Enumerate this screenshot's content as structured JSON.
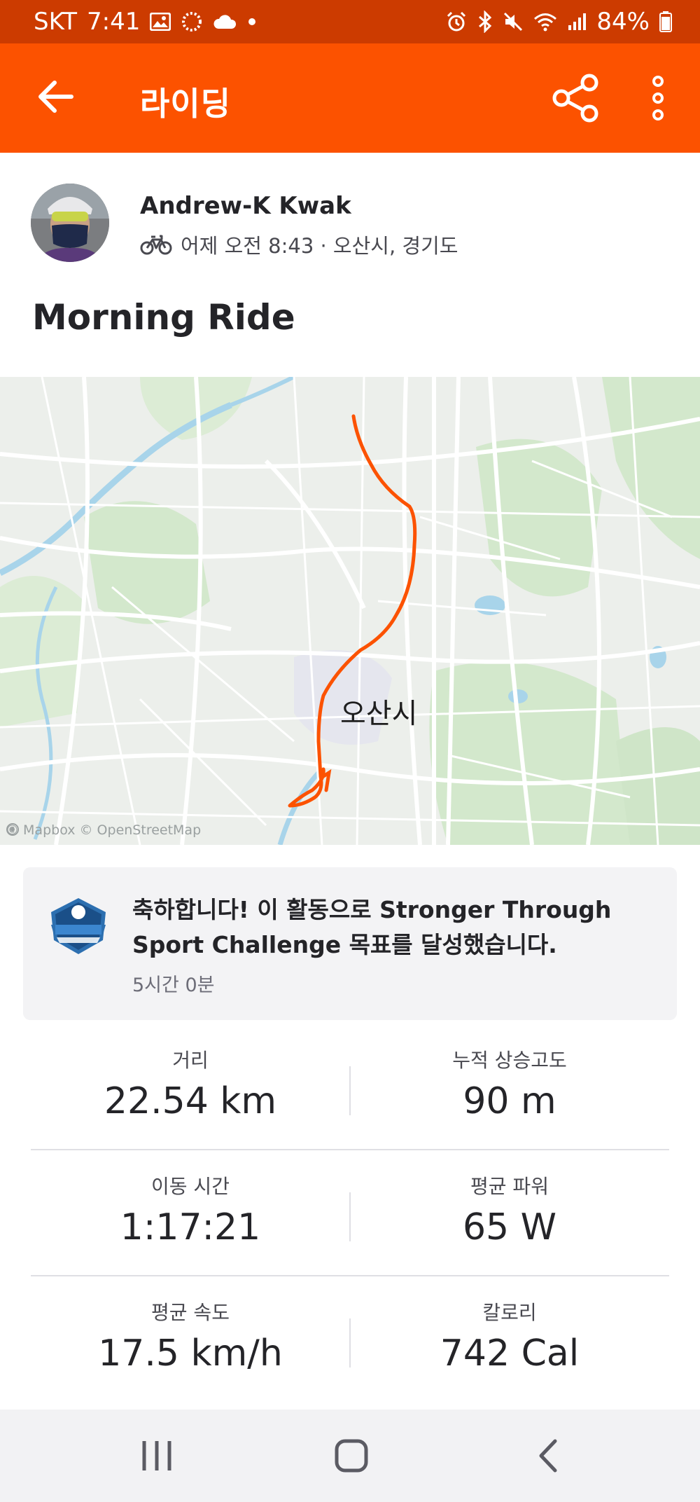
{
  "status_bar": {
    "carrier": "SKT",
    "time": "7:41",
    "battery": "84%",
    "left_icons": [
      "gallery-icon",
      "loading-icon",
      "cloud-icon",
      "dot-icon"
    ],
    "right_icons": [
      "alarm-icon",
      "bluetooth-icon",
      "mute-icon",
      "wifi-icon",
      "signal-icon",
      "battery-icon"
    ]
  },
  "app_bar": {
    "title": "라이딩",
    "back_icon": "arrow-left-icon",
    "share_icon": "share-icon",
    "more_icon": "more-vertical-icon"
  },
  "athlete": {
    "name": "Andrew-K Kwak",
    "meta": "어제 오전 8:43 · 오산시, 경기도",
    "activity_icon": "bicycle-icon"
  },
  "activity": {
    "title": "Morning Ride"
  },
  "map": {
    "city_label": "오산시",
    "attribution": "© Mapbox © OpenStreetMap",
    "route_color": "#fc5200"
  },
  "challenge": {
    "text": "축하합니다! 이 활동으로 Stronger Through Sport Challenge 목표를 달성했습니다.",
    "time": "5시간 0분",
    "badge_icon": "challenge-badge-icon"
  },
  "stats": [
    {
      "label_left": "거리",
      "value_left": "22.54 km",
      "label_right": "누적 상승고도",
      "value_right": "90 m"
    },
    {
      "label_left": "이동 시간",
      "value_left": "1:17:21",
      "label_right": "평균 파워",
      "value_right": "65 W"
    },
    {
      "label_left": "평균 속도",
      "value_left": "17.5 km/h",
      "label_right": "칼로리",
      "value_right": "742 Cal"
    }
  ],
  "nav_bar": {
    "recent_icon": "recent-apps-icon",
    "home_icon": "home-icon",
    "back_icon": "back-chevron-icon"
  },
  "colors": {
    "status_bar": "#cc3b00",
    "brand": "#fc5200",
    "text_primary": "#242428",
    "text_secondary": "#494950"
  }
}
